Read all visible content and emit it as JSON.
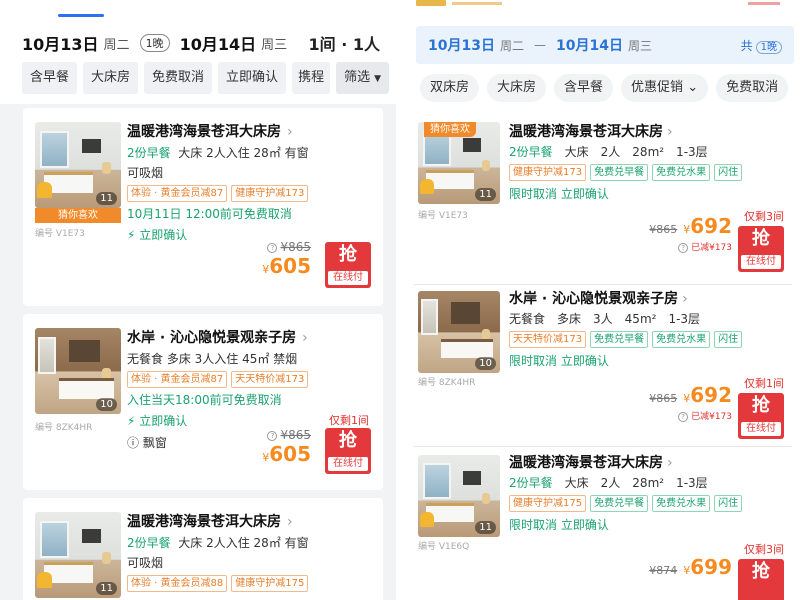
{
  "left": {
    "header": {
      "checkin_date": "10月13日",
      "checkin_week": "周二",
      "nights": "1晚",
      "checkout_date": "10月14日",
      "checkout_week": "周三",
      "guests": "1间 · 1人"
    },
    "filters": [
      {
        "label": "含早餐"
      },
      {
        "label": "大床房"
      },
      {
        "label": "免费取消"
      },
      {
        "label": "立即确认"
      },
      {
        "label": "携程"
      },
      {
        "label": "筛选"
      }
    ],
    "cards": [
      {
        "name": "温暖港湾海景苍洱大床房",
        "breakfast": "2份早餐",
        "spec": "大床  2人入住  28㎡  有窗",
        "spec2": "可吸烟",
        "tags": [
          {
            "text": "体验 · 黄金会员减87"
          },
          {
            "text": "健康守护减173"
          }
        ],
        "cancel": "10月11日 12:00前可免费取消",
        "confirm": "立即确认",
        "photo_count": "11",
        "favorite": "猜你喜欢",
        "code": "编号 V1E73",
        "old_price": "¥865",
        "new_price": "605",
        "yen": "¥",
        "grab": "抢",
        "grab_sub": "在线付"
      },
      {
        "name": "水岸 · 沁心隐悦景观亲子房",
        "spec": "无餐食  多床  3人入住  45㎡  禁烟",
        "tags": [
          {
            "text": "体验 · 黄金会员减87"
          },
          {
            "text": "天天特价减173"
          }
        ],
        "cancel": "入住当天18:00前可免费取消",
        "confirm": "立即确认",
        "window": "飘窗",
        "photo_count": "10",
        "code": "编号 8ZK4HR",
        "remain": "仅剩1间",
        "old_price": "¥865",
        "new_price": "605",
        "yen": "¥",
        "grab": "抢",
        "grab_sub": "在线付"
      },
      {
        "name": "温暖港湾海景苍洱大床房",
        "breakfast": "2份早餐",
        "spec": "大床  2人入住  28㎡  有窗",
        "spec2": "可吸烟",
        "tags": [
          {
            "text": "体验 · 黄金会员减88"
          },
          {
            "text": "健康守护减175"
          }
        ],
        "photo_count": "11"
      }
    ]
  },
  "right": {
    "header": {
      "checkin_date": "10月13日",
      "checkin_week": "周二",
      "sep": "—",
      "checkout_date": "10月14日",
      "checkout_week": "周三",
      "total_label": "共",
      "nights": "1晚"
    },
    "filters": [
      {
        "label": "双床房"
      },
      {
        "label": "大床房"
      },
      {
        "label": "含早餐"
      },
      {
        "label": "优惠促销"
      },
      {
        "label": "免费取消"
      }
    ],
    "cards": [
      {
        "favorite": "猜你喜欢",
        "name": "温暖港湾海景苍洱大床房",
        "breakfast": "2份早餐",
        "bed": "大床",
        "people": "2人",
        "area": "28m²",
        "floor": "1-3层",
        "tags": [
          {
            "text": "健康守护减173",
            "style": "o"
          },
          {
            "text": "免费兑早餐",
            "style": "g"
          },
          {
            "text": "免费兑水果",
            "style": "g"
          },
          {
            "text": "闪住",
            "style": "g"
          }
        ],
        "cancel": "限时取消  立即确认",
        "photo_count": "11",
        "code": "编号 V1E73",
        "remain": "仅剩3间",
        "old_price": "¥865",
        "new_price": "692",
        "yen": "¥",
        "saved": "已减¥173",
        "grab": "抢",
        "grab_sub": "在线付"
      },
      {
        "name": "水岸 · 沁心隐悦景观亲子房",
        "breakfast": "无餐食",
        "bed": "多床",
        "people": "3人",
        "area": "45m²",
        "floor": "1-3层",
        "tags": [
          {
            "text": "天天特价减173",
            "style": "o"
          },
          {
            "text": "免费兑早餐",
            "style": "g"
          },
          {
            "text": "免费兑水果",
            "style": "g"
          },
          {
            "text": "闪住",
            "style": "g"
          }
        ],
        "cancel": "限时取消  立即确认",
        "photo_count": "10",
        "code": "编号 8ZK4HR",
        "remain": "仅剩1间",
        "old_price": "¥865",
        "new_price": "692",
        "yen": "¥",
        "saved": "已减¥173",
        "grab": "抢",
        "grab_sub": "在线付"
      },
      {
        "name": "温暖港湾海景苍洱大床房",
        "breakfast": "2份早餐",
        "bed": "大床",
        "people": "2人",
        "area": "28m²",
        "floor": "1-3层",
        "tags": [
          {
            "text": "健康守护减175",
            "style": "o"
          },
          {
            "text": "免费兑早餐",
            "style": "g"
          },
          {
            "text": "免费兑水果",
            "style": "g"
          },
          {
            "text": "闪住",
            "style": "g"
          }
        ],
        "cancel": "限时取消  立即确认",
        "photo_count": "11",
        "code": "编号 V1E6Q",
        "remain": "仅剩3间",
        "old_price": "¥874",
        "new_price": "699",
        "yen": "¥",
        "grab": "抢"
      }
    ]
  },
  "colors": {
    "accent_blue": "#2a6ff5",
    "price_orange": "#f58a1f",
    "grab_red": "#e4393c",
    "tag_green": "#1aa26f",
    "tag_orange": "#e87e2b"
  },
  "icons": [
    "lightning-icon",
    "question-icon",
    "window-icon",
    "chevron-right-icon",
    "caret-down-icon"
  ]
}
